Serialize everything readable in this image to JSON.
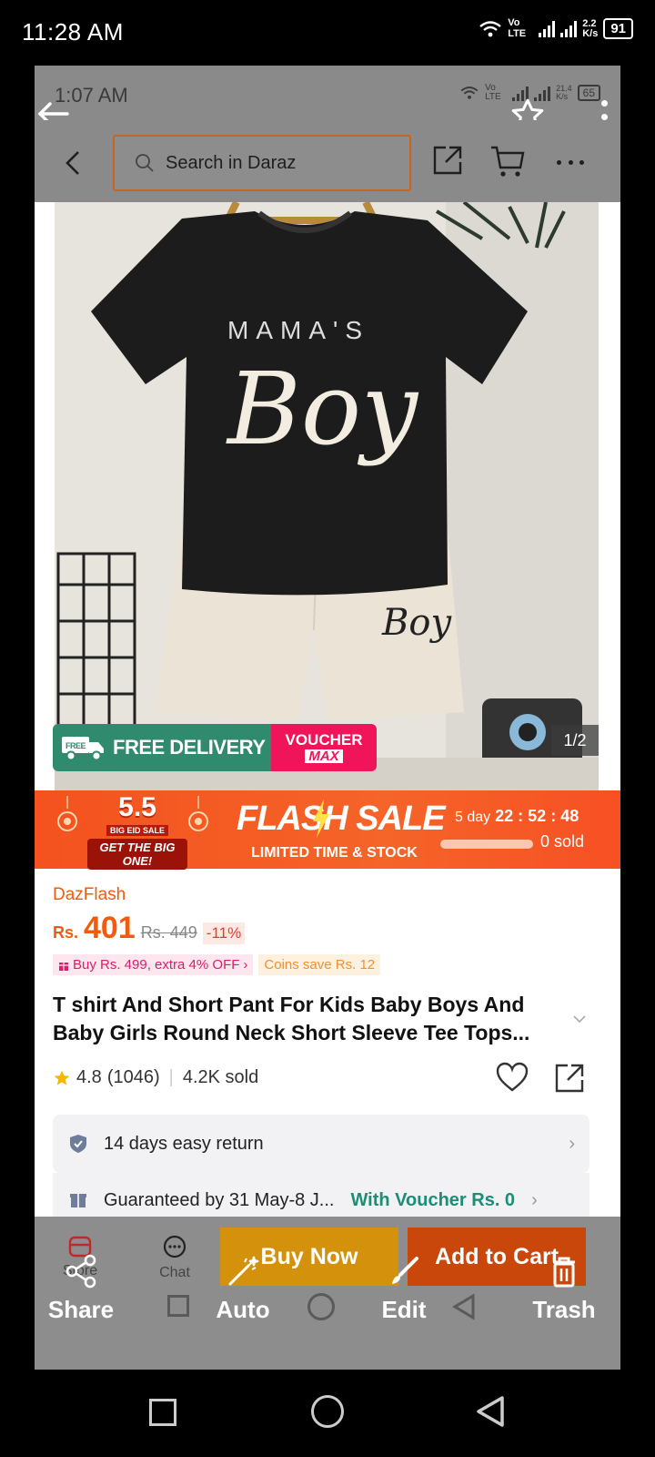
{
  "outer_status": {
    "time": "11:28 AM",
    "lte": "Vo LTE",
    "speed": "2.2",
    "speed_unit": "K/s",
    "battery": "91"
  },
  "inner_status": {
    "time": "1:07 AM",
    "lte": "Vo LTE",
    "speed": "21.4",
    "speed_unit": "K/s",
    "battery": "65"
  },
  "search": {
    "placeholder": "Search in Daraz"
  },
  "image": {
    "counter": "1/2",
    "shirt_text_top": "MAMA'S",
    "shirt_text_script": "Boy",
    "shorts_text": "Boy"
  },
  "delivery": {
    "free_small": "FREE",
    "label": "FREE DELIVERY",
    "voucher_top": "VOUCHER",
    "voucher_bottom": "MAX"
  },
  "flash": {
    "badge_number": "5.5",
    "badge_line1": "BIG EID SALE",
    "badge_line2": "GET THE BIG ONE!",
    "title": "FLASH SALE",
    "subtitle": "LIMITED TIME & STOCK",
    "days": "5 day",
    "hours": "22",
    "minutes": "52",
    "seconds": "48",
    "sep": ":",
    "sold": "0 sold",
    "sold_progress": 0
  },
  "product": {
    "seller_tag": "DazFlash",
    "currency": "Rs.",
    "price": "401",
    "old_price": "Rs. 449",
    "discount": "-11%",
    "promo": "Buy Rs. 499, extra 4% OFF",
    "coins": "Coins save Rs. 12",
    "title": "T shirt And Short Pant For Kids Baby Boys And Baby Girls Round Neck Short Sleeve Tee Tops...",
    "rating": "4.8",
    "reviews": "(1046)",
    "sold": "4.2K sold",
    "return_policy": "14 days easy return",
    "guarantee": "Guaranteed by 31 May-8 J...",
    "voucher": "With Voucher Rs. 0"
  },
  "actions": {
    "store": "Store",
    "chat": "Chat",
    "buy_now": "Buy Now",
    "add_to_cart": "Add to Cart"
  },
  "toolbar": {
    "share": "Share",
    "auto": "Auto",
    "edit": "Edit",
    "trash": "Trash"
  },
  "colors": {
    "accent": "#f85606",
    "flash": "#f4521e",
    "buy_now": "#d4920c",
    "add_cart": "#c9470a",
    "delivery": "#2f8a6e",
    "voucher": "#f0145a"
  }
}
